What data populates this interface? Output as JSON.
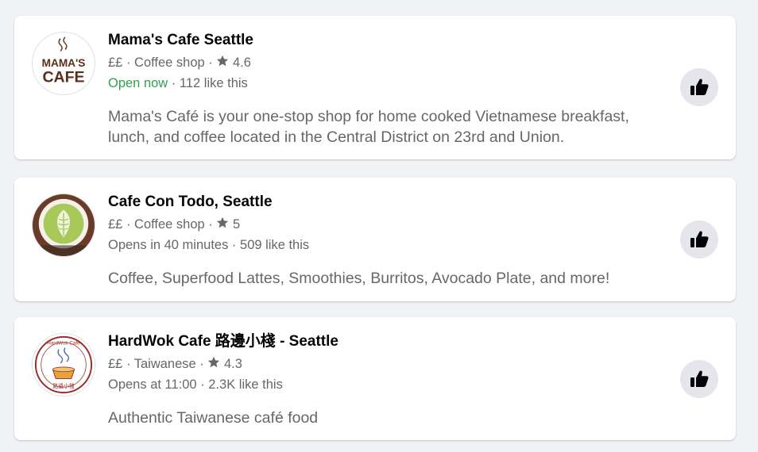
{
  "places": [
    {
      "name": "Mama's Cafe Seattle",
      "price": "££",
      "category": "Coffee shop",
      "rating": "4.6",
      "status": "Open now",
      "likes": "112 like this",
      "description": "Mama's Café is your one-stop shop for home cooked Vietnamese breakfast, lunch, and coffee located in the Central District on 23rd and Union.",
      "logo_text": [
        "MAMA'S",
        "CAFE"
      ]
    },
    {
      "name": "Cafe Con Todo, Seattle",
      "price": "££",
      "category": "Coffee shop",
      "rating": "5",
      "status": "Opens in 40 minutes",
      "likes": "509 like this",
      "description": "Coffee, Superfood Lattes, Smoothies, Burritos, Avocado Plate, and more!"
    },
    {
      "name": "HardWok Cafe 路邊小棧 - Seattle",
      "price": "££",
      "category": "Taiwanese",
      "rating": "4.3",
      "status": "Opens at 11:00",
      "likes": "2.3K like this",
      "description": "Authentic Taiwanese café food",
      "logo_text": [
        "HardWok Cafe",
        "路邊小棧"
      ]
    }
  ],
  "separator": " · ",
  "colors": {
    "open": "#31a24c",
    "secondary_text": "#65676b",
    "primary_text": "#050505",
    "button_bg": "#e4e6eb"
  },
  "icons": {
    "rating": "star-icon",
    "like": "thumbs-up-icon"
  }
}
